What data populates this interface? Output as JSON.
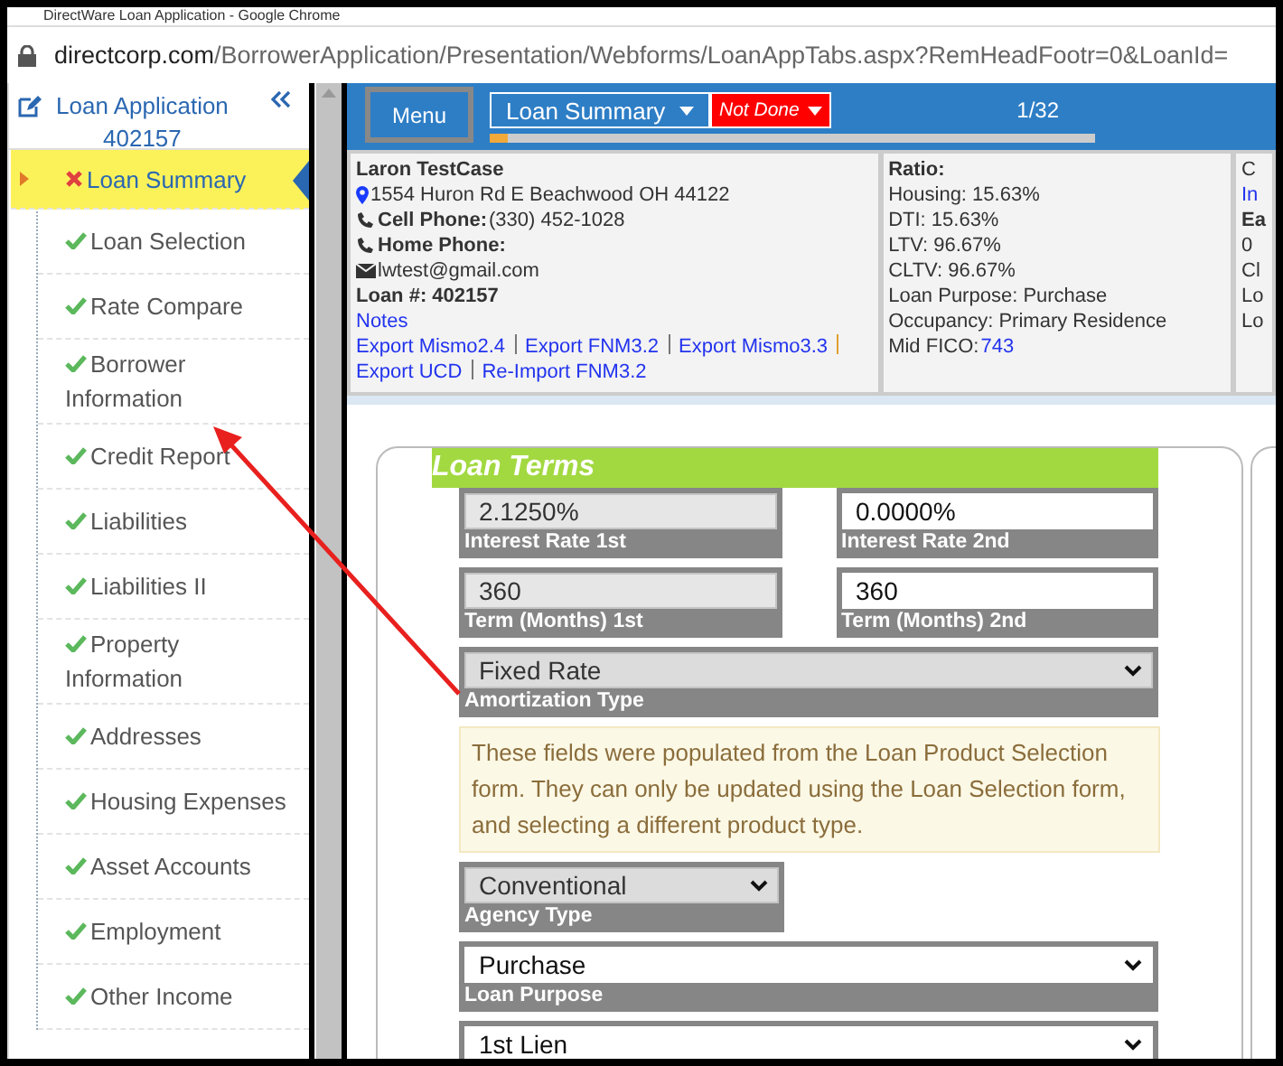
{
  "browser": {
    "title": "DirectWare Loan Application - Google Chrome",
    "url_domain": "directcorp.com",
    "url_path": "/BorrowerApplication/Presentation/Webforms/LoanAppTabs.aspx?RemHeadFootr=0&LoanId="
  },
  "sidebar": {
    "title": "Loan Application",
    "loan_number": "402157",
    "items": [
      {
        "label": "Loan Summary",
        "complete": false,
        "selected": true
      },
      {
        "label": "Loan Selection",
        "complete": true,
        "selected": false
      },
      {
        "label": "Rate Compare",
        "complete": true,
        "selected": false
      },
      {
        "label": "Borrower Information",
        "complete": true,
        "selected": false
      },
      {
        "label": "Credit Report",
        "complete": true,
        "selected": false
      },
      {
        "label": "Liabilities",
        "complete": true,
        "selected": false
      },
      {
        "label": "Liabilities II",
        "complete": true,
        "selected": false
      },
      {
        "label": "Property Information",
        "complete": true,
        "selected": false
      },
      {
        "label": "Addresses",
        "complete": true,
        "selected": false
      },
      {
        "label": "Housing Expenses",
        "complete": true,
        "selected": false
      },
      {
        "label": "Asset Accounts",
        "complete": true,
        "selected": false
      },
      {
        "label": "Employment",
        "complete": true,
        "selected": false
      },
      {
        "label": "Other Income",
        "complete": true,
        "selected": false
      }
    ]
  },
  "header": {
    "menu_button": "Menu",
    "page_select": "Loan Summary",
    "status_select": "Not Done",
    "progress": {
      "level": 0.03,
      "text": "1/32"
    }
  },
  "borrower": {
    "name": "Laron TestCase",
    "address": "1554 Huron Rd E Beachwood OH 44122",
    "cell_label": "Cell Phone:",
    "cell_value": "(330) 452-1028",
    "home_label": "Home Phone:",
    "email": "lwtest@gmail.com",
    "loan_label": "Loan #: 402157",
    "notes_link": "Notes",
    "links": [
      "Export Mismo2.4",
      "Export FNM3.2",
      "Export Mismo3.3",
      "Export UCD",
      "Re-Import FNM3.2"
    ]
  },
  "ratio": {
    "title": "Ratio:",
    "lines": [
      "Housing: 15.63%",
      "DTI: 15.63%",
      "LTV: 96.67%",
      "CLTV: 96.67%",
      "Loan Purpose: Purchase",
      "Occupancy: Primary Residence"
    ],
    "fico_label": "Mid FICO:",
    "fico_value": "743"
  },
  "column_3": {
    "lines": [
      {
        "text": "C",
        "kind": "plain"
      },
      {
        "text": "In",
        "kind": "link"
      },
      {
        "text": "Ea",
        "kind": "bold"
      },
      {
        "text": "0",
        "kind": "plain"
      },
      {
        "text": "Cl",
        "kind": "plain"
      },
      {
        "text": "Lo",
        "kind": "plain"
      },
      {
        "text": "Lo",
        "kind": "plain"
      }
    ]
  },
  "loan_terms": {
    "title": "Loan Terms",
    "rows": [
      {
        "kind": "pair",
        "fields": [
          {
            "kind": "input",
            "value": "2.1250%",
            "label": "Interest Rate 1st",
            "disabled": true
          },
          {
            "kind": "input",
            "value": "0.0000%",
            "label": "Interest Rate 2nd",
            "disabled": false
          }
        ]
      },
      {
        "kind": "pair",
        "fields": [
          {
            "kind": "input",
            "value": "360",
            "label": "Term (Months) 1st",
            "disabled": true
          },
          {
            "kind": "input",
            "value": "360",
            "label": "Term (Months) 2nd",
            "disabled": false
          }
        ]
      },
      {
        "kind": "full",
        "fields": [
          {
            "kind": "select",
            "value": "Fixed Rate",
            "label": "Amortization Type",
            "disabled": true
          }
        ]
      },
      {
        "kind": "notice",
        "text": "These fields were populated from the Loan Product Selection form. They can only be updated using the Loan Selection form, and selecting a different product type."
      },
      {
        "kind": "pair",
        "fields": [
          {
            "kind": "select",
            "value": "Conventional",
            "label": "Agency Type",
            "disabled": true
          }
        ]
      },
      {
        "kind": "full",
        "fields": [
          {
            "kind": "select",
            "value": "Purchase",
            "label": "Loan Purpose",
            "disabled": false
          }
        ]
      },
      {
        "kind": "full",
        "fields": [
          {
            "kind": "select",
            "value": "1st Lien",
            "disabled": false
          }
        ]
      }
    ]
  }
}
